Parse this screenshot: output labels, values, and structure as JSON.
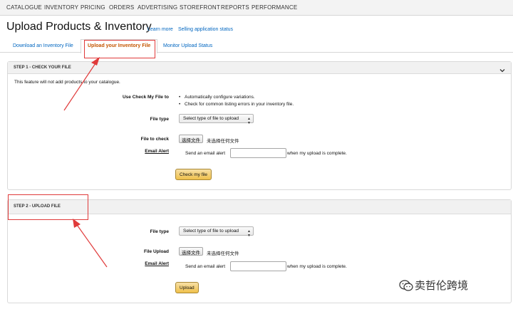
{
  "nav": {
    "items": [
      "CATALOGUE",
      "INVENTORY",
      "PRICING",
      "ORDERS",
      "ADVERTISING",
      "STOREFRONT",
      "REPORTS",
      "PERFORMANCE"
    ]
  },
  "header": {
    "title": "Upload Products & Inventory",
    "learn_more": "Learn more",
    "app_status": "Selling application status"
  },
  "tabs": {
    "download": "Download an Inventory File",
    "upload": "Upload your Inventory File",
    "monitor": "Monitor Upload Status"
  },
  "step1": {
    "heading": "STEP 1 - CHECK YOUR FILE",
    "note": "This feature will not add products to your catalogue.",
    "use_check_label": "Use Check My File to",
    "bullets": [
      "Automatically configure variations.",
      "Check for common listing errors in your inventory file."
    ],
    "file_type_label": "File type",
    "file_type_value": "Select type of file to upload",
    "file_to_check_label": "File to check",
    "choose_file_button": "选择文件",
    "no_file_text": "未选择任何文件",
    "email_alert_label": "Email Alert",
    "email_prefix": "Send an email alert",
    "email_value": "",
    "email_suffix": "when my upload is complete.",
    "check_button": "Check my file"
  },
  "step2": {
    "heading": "STEP 2 - UPLOAD FILE",
    "file_type_label": "File type",
    "file_type_value": "Select type of file to upload",
    "file_upload_label": "File Upload",
    "choose_file_button": "选择文件",
    "no_file_text": "未选择任何文件",
    "email_alert_label": "Email Alert",
    "email_prefix": "Send an email alert",
    "email_value": "",
    "email_suffix": "when my upload is complete.",
    "upload_button": "Upload"
  },
  "watermark": {
    "text": "卖哲伦跨境"
  },
  "colors": {
    "link": "#0066c0",
    "active_tab": "#c45500",
    "annotation_red": "#e03a3a",
    "button_yellow": "#f0c14b"
  },
  "icons": {
    "collapse": "chevron-down-icon",
    "dropdown": "caret-down-icon",
    "watermark": "wechat-icon"
  }
}
